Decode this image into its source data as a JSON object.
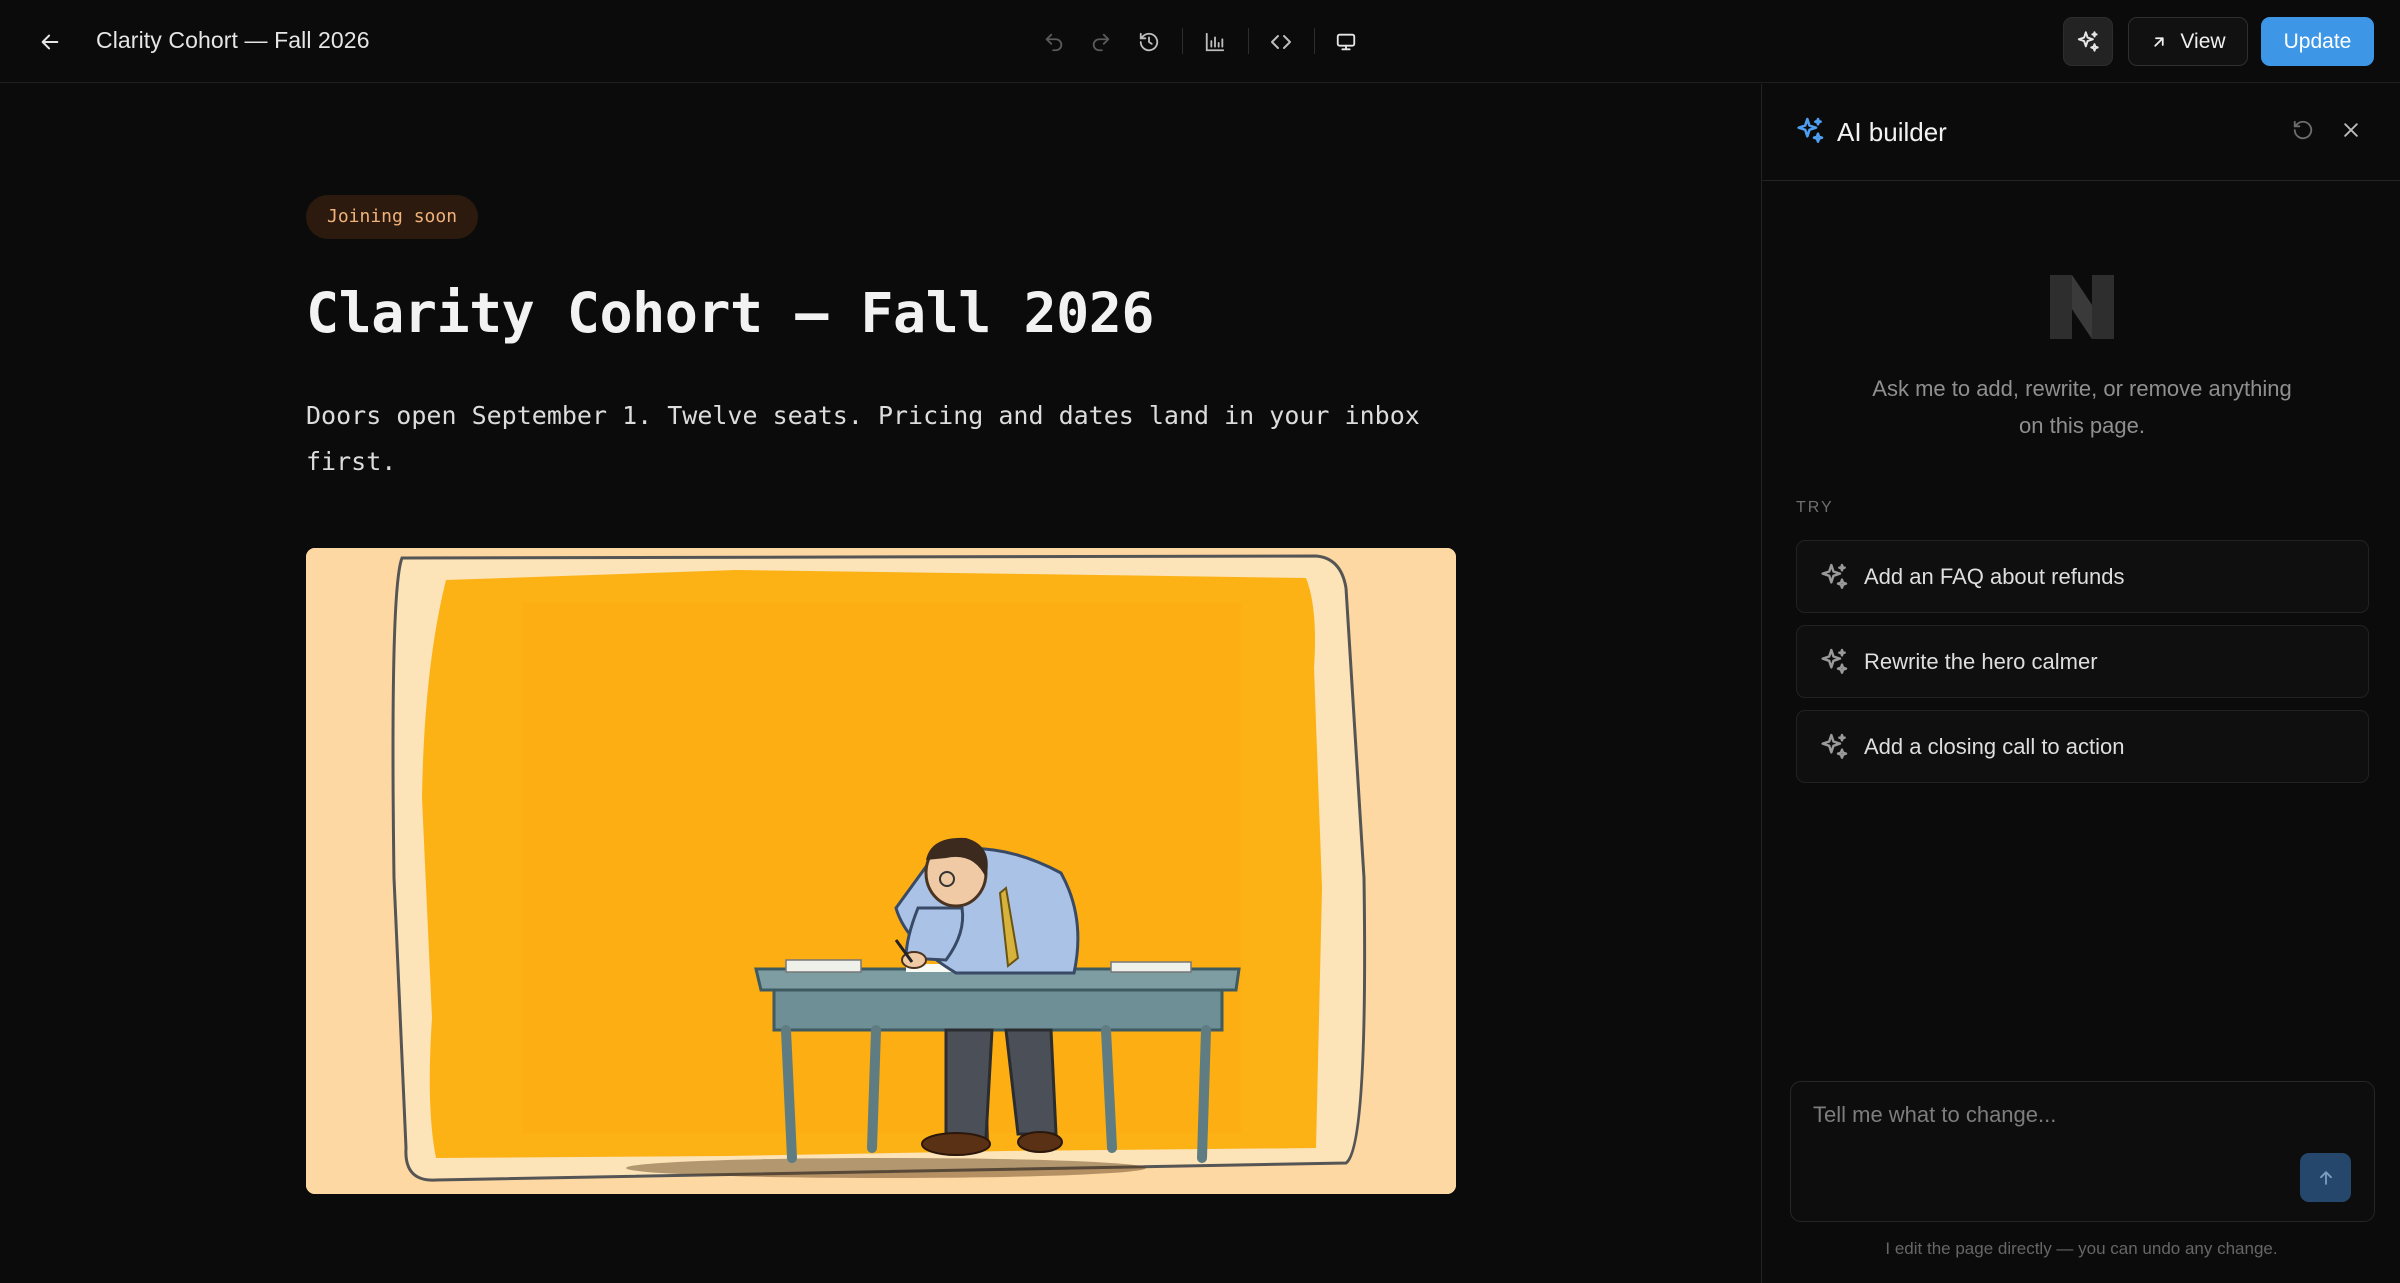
{
  "header": {
    "back_icon": "arrow-left-icon",
    "page_name": "Clarity Cohort — Fall 2026",
    "tools": [
      "undo-icon",
      "redo-icon",
      "history-icon",
      "analytics-icon",
      "code-icon",
      "desktop-preview-icon"
    ],
    "view_label": "View",
    "update_label": "Update",
    "accent": "#3d96e6"
  },
  "hero": {
    "badge": "Joining soon",
    "title": "Clarity Cohort — Fall 2026",
    "subtitle": "Doors open September 1. Twelve seats. Pricing and dates land in your inbox first.",
    "image_subject": "illustration of a man writing at a desk on an orange background"
  },
  "ai_panel": {
    "title": "AI builder",
    "intro": "Ask me to add, rewrite, or remove anything on this page.",
    "try_label": "TRY",
    "suggestions": [
      "Add an FAQ about refunds",
      "Rewrite the hero calmer",
      "Add a closing call to action"
    ],
    "composer_placeholder": "Tell me what to change...",
    "footnote": "I edit the page directly — you can undo any change."
  }
}
